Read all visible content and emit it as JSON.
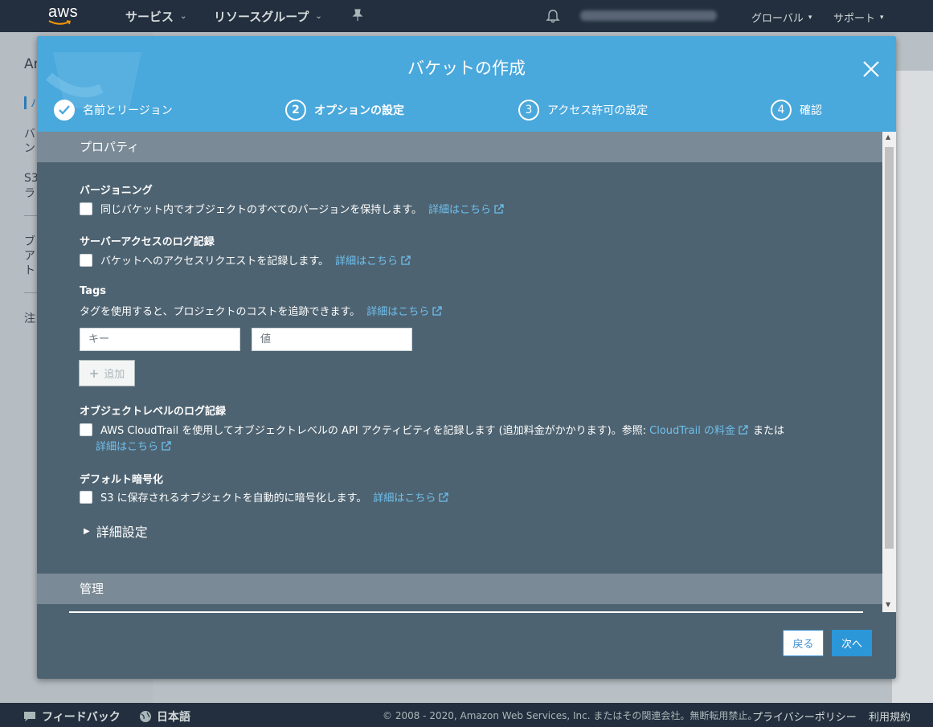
{
  "nav": {
    "logo": "aws",
    "services": "サービス",
    "resource_groups": "リソースグループ",
    "region": "グローバル",
    "support": "サポート"
  },
  "background": {
    "sidebar_texts": [
      "Am",
      "バ",
      "ン",
      "S3",
      "ラ",
      "ブ",
      "ア",
      "ト",
      "注"
    ]
  },
  "modal": {
    "title": "バケットの作成",
    "steps": [
      {
        "num": "✓",
        "label": "名前とリージョン",
        "state": "done"
      },
      {
        "num": "2",
        "label": "オプションの設定",
        "state": "active"
      },
      {
        "num": "3",
        "label": "アクセス許可の設定",
        "state": "pending"
      },
      {
        "num": "4",
        "label": "確認",
        "state": "pending"
      }
    ],
    "properties_header": "プロパティ",
    "versioning": {
      "title": "バージョニング",
      "text": "同じバケット内でオブジェクトのすべてのバージョンを保持します。",
      "link": "詳細はこちら"
    },
    "access_log": {
      "title": "サーバーアクセスのログ記録",
      "text": "バケットへのアクセスリクエストを記録します。",
      "link": "詳細はこちら"
    },
    "tags": {
      "title": "Tags",
      "text": "タグを使用すると、プロジェクトのコストを追跡できます。",
      "link": "詳細はこちら",
      "key_placeholder": "キー",
      "value_placeholder": "値",
      "add_label": "追加"
    },
    "object_log": {
      "title": "オブジェクトレベルのログ記録",
      "text": "AWS CloudTrail を使用してオブジェクトレベルの API アクティビティを記録します (追加料金がかかります)。参照:",
      "link1": "CloudTrail の料金",
      "or": "または",
      "link2": "詳細はこちら"
    },
    "encryption": {
      "title": "デフォルト暗号化",
      "text": "S3 に保存されるオブジェクトを自動的に暗号化します。",
      "link": "詳細はこちら"
    },
    "advanced": "詳細設定",
    "management_header": "管理",
    "back_button": "戻る",
    "next_button": "次へ"
  },
  "footer": {
    "feedback": "フィードバック",
    "language": "日本語",
    "copyright": "© 2008 - 2020, Amazon Web Services, Inc. またはその関連会社。無断転用禁止。",
    "privacy": "プライバシーポリシー",
    "terms": "利用規約"
  },
  "colors": {
    "nav_bg": "#232f3e",
    "modal_header": "#49a8dc",
    "modal_body": "#4e6371",
    "section_bar": "#7a8a96",
    "link": "#6ec0ef",
    "primary_button": "#2b96d8"
  }
}
